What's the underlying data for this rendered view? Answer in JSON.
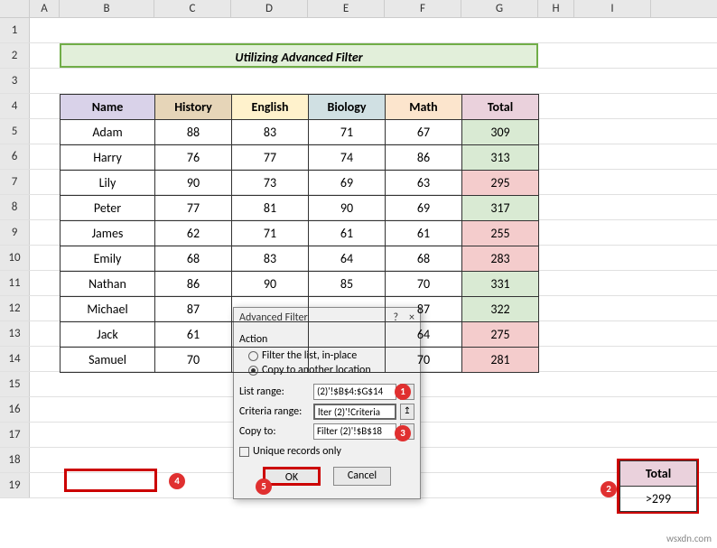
{
  "title": "Utilizing Advanced Filter",
  "columns": [
    "A",
    "B",
    "C",
    "D",
    "E",
    "F",
    "G",
    "H",
    "I"
  ],
  "rowNumbers": [
    "1",
    "2",
    "3",
    "4",
    "5",
    "6",
    "7",
    "8",
    "9",
    "10",
    "11",
    "12",
    "13",
    "14",
    "15",
    "16",
    "17",
    "18",
    "19"
  ],
  "headers": {
    "name": "Name",
    "history": "History",
    "english": "English",
    "biology": "Biology",
    "math": "Math",
    "total": "Total"
  },
  "rows": [
    {
      "name": "Adam",
      "history": "88",
      "english": "83",
      "biology": "71",
      "math": "67",
      "total": "309",
      "hl": "green"
    },
    {
      "name": "Harry",
      "history": "76",
      "english": "77",
      "biology": "74",
      "math": "86",
      "total": "313",
      "hl": "green"
    },
    {
      "name": "Lily",
      "history": "90",
      "english": "73",
      "biology": "69",
      "math": "63",
      "total": "295",
      "hl": "red"
    },
    {
      "name": "Peter",
      "history": "77",
      "english": "81",
      "biology": "90",
      "math": "69",
      "total": "317",
      "hl": "green"
    },
    {
      "name": "James",
      "history": "62",
      "english": "71",
      "biology": "61",
      "math": "61",
      "total": "255",
      "hl": "red"
    },
    {
      "name": "Emily",
      "history": "68",
      "english": "83",
      "biology": "64",
      "math": "68",
      "total": "283",
      "hl": "red"
    },
    {
      "name": "Nathan",
      "history": "86",
      "english": "90",
      "biology": "85",
      "math": "70",
      "total": "331",
      "hl": "green"
    },
    {
      "name": "Michael",
      "history": "87",
      "english": "",
      "biology": "",
      "math": "87",
      "total": "322",
      "hl": "green"
    },
    {
      "name": "Jack",
      "history": "61",
      "english": "",
      "biology": "",
      "math": "64",
      "total": "275",
      "hl": "red"
    },
    {
      "name": "Samuel",
      "history": "70",
      "english": "",
      "biology": "",
      "math": "70",
      "total": "281",
      "hl": "red"
    }
  ],
  "dialog": {
    "title": "Advanced Filter",
    "help": "?",
    "close": "×",
    "action_label": "Action",
    "radio1": "Filter the list, in-place",
    "radio2": "Copy to another location",
    "list_label": "List range:",
    "list_value": "(2)'!$B$4:$G$14",
    "crit_label": "Criteria range:",
    "crit_value": "lter (2)'!Criteria",
    "copy_label": "Copy to:",
    "copy_value": "Filter (2)'!$B$18",
    "unique": "Unique records only",
    "ok": "OK",
    "cancel": "Cancel"
  },
  "criteria": {
    "header": "Total",
    "value": ">299"
  },
  "markers": {
    "m1": "1",
    "m2": "2",
    "m3": "3",
    "m4": "4",
    "m5": "5"
  },
  "watermark": "wsxdn.com"
}
